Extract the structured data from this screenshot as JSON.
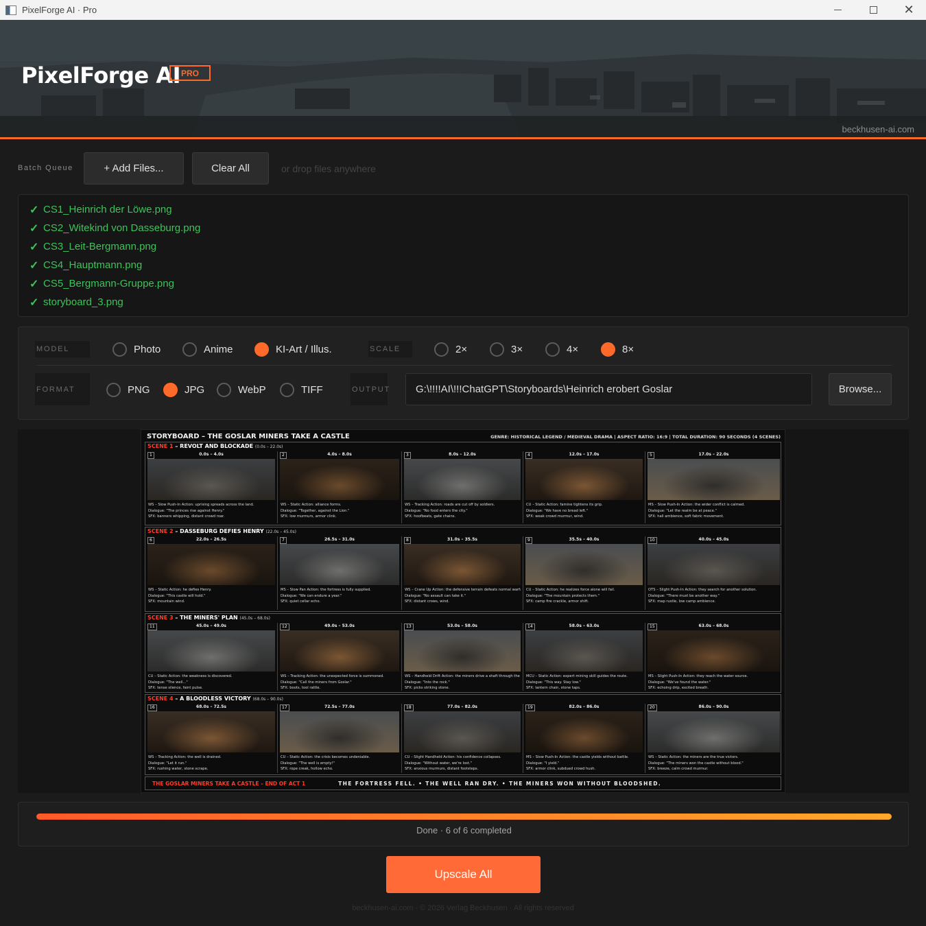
{
  "window": {
    "title": "PixelForge AI · Pro",
    "minimize": "",
    "maximize": "",
    "close": "✕"
  },
  "header": {
    "brand": "PixelForge AI",
    "badge": "PRO",
    "site": "beckhusen-ai.com"
  },
  "queue": {
    "label": "Batch Queue",
    "add_label": "+ Add Files...",
    "clear_label": "Clear All",
    "drop_hint": "or drop files anywhere",
    "check": "✓",
    "files": [
      "CS1_Heinrich der Löwe.png",
      "CS2_Witekind von Dasseburg.png",
      "CS3_Leit-Bergmann.png",
      "CS4_Hauptmann.png",
      "CS5_Bergmann-Gruppe.png",
      "storyboard_3.png"
    ]
  },
  "settings": {
    "model_label": "MODEL",
    "models": [
      "Photo",
      "Anime",
      "KI-Art / Illus."
    ],
    "model_selected": "KI-Art / Illus.",
    "scale_label": "SCALE",
    "scales": [
      "2×",
      "3×",
      "4×",
      "8×"
    ],
    "scale_selected": "8×",
    "format_label": "FORMAT",
    "formats": [
      "PNG",
      "JPG",
      "WebP",
      "TIFF"
    ],
    "format_selected": "JPG",
    "output_label": "OUTPUT",
    "output_path": "G:\\!!!!AI\\!!!ChatGPT\\Storyboards\\Heinrich erobert Goslar",
    "browse_label": "Browse..."
  },
  "preview": {
    "title": "STORYBOARD – THE GOSLAR MINERS TAKE A CASTLE",
    "meta": "GENRE: HISTORICAL LEGEND / MEDIEVAL DRAMA  |  ASPECT RATIO: 16:9  |  TOTAL DURATION: 90 SECONDS (4 SCENES)",
    "scenes": [
      {
        "num": "SCENE 1",
        "title": " – REVOLT AND BLOCKADE",
        "time": "(0.0s – 22.0s)",
        "shots": [
          {
            "n": "1",
            "t": "0.0s – 4.0s",
            "l1": "WS – Slow Push-In  Action: uprising spreads across the land.",
            "l2": "Dialogue: \"The princes rise against Henry.\"",
            "l3": "SFX: banners whipping, distant crowd roar."
          },
          {
            "n": "2",
            "t": "4.0s – 8.0s",
            "l1": "WS – Static  Action: alliance forms.",
            "l2": "Dialogue: \"Together, against the Lion.\"",
            "l3": "SFX: low murmurs, armor clink."
          },
          {
            "n": "3",
            "t": "8.0s – 12.0s",
            "l1": "WS – Tracking  Action: roads are cut off by soldiers.",
            "l2": "Dialogue: \"No food enters the city.\"",
            "l3": "SFX: hoofbeats, gate chains."
          },
          {
            "n": "4",
            "t": "12.0s – 17.0s",
            "l1": "CU – Static  Action: famine tightens its grip.",
            "l2": "Dialogue: \"We have no bread left.\"",
            "l3": "SFX: weak crowd murmur, wind."
          },
          {
            "n": "5",
            "t": "17.0s – 22.0s",
            "l1": "MS – Slow Push-In  Action: the wider conflict is calmed.",
            "l2": "Dialogue: \"Let the realm be at peace.\"",
            "l3": "SFX: hall ambience, soft fabric movement."
          }
        ]
      },
      {
        "num": "SCENE 2",
        "title": " – DASSEBURG DEFIES HENRY",
        "time": "(22.0s – 45.0s)",
        "shots": [
          {
            "n": "6",
            "t": "22.0s – 26.5s",
            "l1": "WS – Static  Action: he defies Henry.",
            "l2": "Dialogue: \"This castle will hold.\"",
            "l3": "SFX: mountain wind."
          },
          {
            "n": "7",
            "t": "26.5s – 31.0s",
            "l1": "MS – Slow Pan  Action: the fortress is fully supplied.",
            "l2": "Dialogue: \"We can endure a year.\"",
            "l3": "SFX: quiet cellar echo."
          },
          {
            "n": "8",
            "t": "31.0s – 35.5s",
            "l1": "WS – Crane Up  Action: the defensive terrain defeats normal warfare.",
            "l2": "Dialogue: \"No assault can take it.\"",
            "l3": "SFX: distant crows, wind."
          },
          {
            "n": "9",
            "t": "35.5s – 40.0s",
            "l1": "CU – Static  Action: he realizes force alone will fail.",
            "l2": "Dialogue: \"The mountain protects them.\"",
            "l3": "SFX: camp fire crackle, armor shift."
          },
          {
            "n": "10",
            "t": "40.0s – 45.0s",
            "l1": "OTS – Slight Push-In  Action: they search for another solution.",
            "l2": "Dialogue: \"There must be another way.\"",
            "l3": "SFX: map rustle, low camp ambience."
          }
        ]
      },
      {
        "num": "SCENE 3",
        "title": " – THE MINERS' PLAN",
        "time": "(45.0s – 68.0s)",
        "shots": [
          {
            "n": "11",
            "t": "45.0s – 49.0s",
            "l1": "CU – Static  Action: the weakness is discovered.",
            "l2": "Dialogue: \"The well...\"",
            "l3": "SFX: tense silence, faint pulse."
          },
          {
            "n": "12",
            "t": "49.0s – 53.0s",
            "l1": "WS – Tracking  Action: the unexpected force is summoned.",
            "l2": "Dialogue: \"Call the miners from Goslar.\"",
            "l3": "SFX: boots, tool rattle."
          },
          {
            "n": "13",
            "t": "53.0s – 58.0s",
            "l1": "WS – Handheld Drift  Action: the miners drive a shaft through the hill.",
            "l2": "Dialogue: \"Into the rock.\"",
            "l3": "SFX: picks striking stone."
          },
          {
            "n": "14",
            "t": "58.0s – 63.0s",
            "l1": "MCU – Static  Action: expert mining skill guides the route.",
            "l2": "Dialogue: \"This way. Stay low.\"",
            "l3": "SFX: lantern chain, stone taps."
          },
          {
            "n": "15",
            "t": "63.0s – 68.0s",
            "l1": "MS – Slight Push-In  Action: they reach the water source.",
            "l2": "Dialogue: \"We've found the water.\"",
            "l3": "SFX: echoing drip, excited breath."
          }
        ]
      },
      {
        "num": "SCENE 4",
        "title": " – A BLOODLESS VICTORY",
        "time": "(68.0s – 90.0s)",
        "shots": [
          {
            "n": "16",
            "t": "68.0s – 72.5s",
            "l1": "WS – Tracking  Action: the well is drained.",
            "l2": "Dialogue: \"Let it run.\"",
            "l3": "SFX: rushing water, stone scrape."
          },
          {
            "n": "17",
            "t": "72.5s – 77.0s",
            "l1": "CU – Static  Action: the crisis becomes undeniable.",
            "l2": "Dialogue: \"The well is empty!\"",
            "l3": "SFX: rope creak, hollow echo."
          },
          {
            "n": "18",
            "t": "77.0s – 82.0s",
            "l1": "CU – Slight Handheld  Action: his confidence collapses.",
            "l2": "Dialogue: \"Without water, we're lost.\"",
            "l3": "SFX: anxious murmurs, distant footsteps."
          },
          {
            "n": "19",
            "t": "82.0s – 86.0s",
            "l1": "MS – Slow Push-In  Action: the castle yields without battle.",
            "l2": "Dialogue: \"I yield.\"",
            "l3": "SFX: armor clink, subdued crowd hush."
          },
          {
            "n": "20",
            "t": "86.0s – 90.0s",
            "l1": "WS – Static  Action: the miners are the true victors.",
            "l2": "Dialogue: \"The miners won the castle without blood.\"",
            "l3": "SFX: breeze, calm crowd murmur."
          }
        ]
      }
    ],
    "footer_red": "THE GOSLAR MINERS TAKE A CASTLE – END OF ACT 1",
    "footer_white": "THE FORTRESS FELL.  •  THE WELL RAN DRY.  •  THE MINERS WON WITHOUT BLOODSHED."
  },
  "progress": {
    "value": 1.0,
    "status": "Done  ·  6 of 6 completed"
  },
  "actions": {
    "upscale_label": "Upscale All"
  },
  "footer": {
    "text": "beckhusen-ai.com  ·  © 2026 Verlag Beckhusen  ·  All rights reserved"
  },
  "colors": {
    "accent": "#ff6a2a",
    "success": "#3ec25a",
    "background": "#1b1b1b"
  }
}
